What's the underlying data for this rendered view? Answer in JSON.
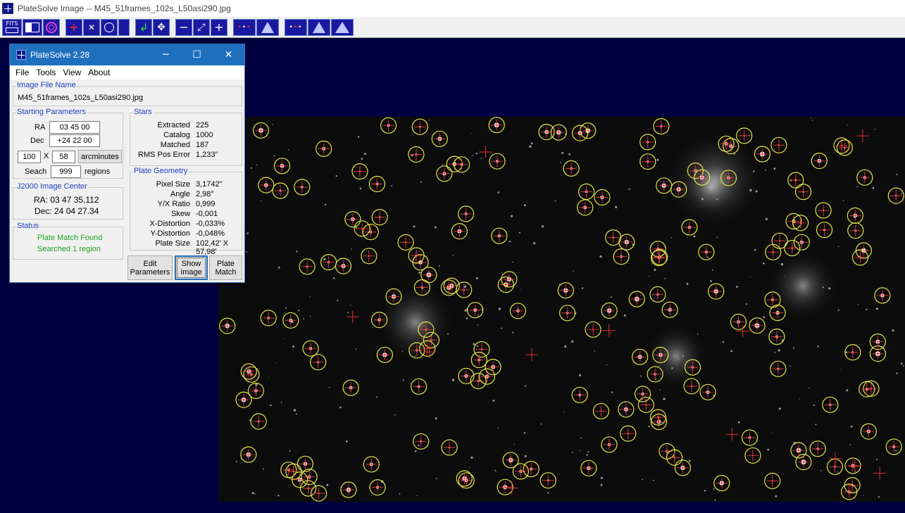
{
  "main_window": {
    "title": "PlateSolve Image -- M45_51frames_102s_L50asi290.jpg"
  },
  "toolbar": {
    "buttons": [
      {
        "name": "fits-button",
        "label": "FITS"
      },
      {
        "name": "image-layout-button",
        "icon": "panel-icon"
      },
      {
        "name": "target-circle-button",
        "icon": "target-icon"
      },
      {
        "name": "crosshair-button",
        "icon": "plus-icon"
      },
      {
        "name": "x-mark-button",
        "icon": "x-icon"
      },
      {
        "name": "circle-button",
        "icon": "circle-icon"
      },
      {
        "name": "blank-button",
        "icon": "blank-icon"
      },
      {
        "name": "rotate-button",
        "icon": "rotate-arrow-icon"
      },
      {
        "name": "move-button",
        "icon": "move-arrows-icon"
      },
      {
        "name": "zoom-out-button",
        "label": "−"
      },
      {
        "name": "fit-window-button",
        "icon": "expand-icon"
      },
      {
        "name": "zoom-in-button",
        "label": "+"
      },
      {
        "name": "stars-left-button",
        "icon": "dots-icon"
      },
      {
        "name": "histogram-button",
        "icon": "histogram-icon"
      },
      {
        "name": "stars-right-button",
        "icon": "dots-icon"
      },
      {
        "name": "histogram-red-button",
        "icon": "histogram-icon"
      },
      {
        "name": "histogram-wide-button",
        "icon": "histogram-icon"
      }
    ]
  },
  "dialog": {
    "title": "PlateSolve 2.28",
    "menu": [
      "File",
      "Tools",
      "View",
      "About"
    ],
    "image_file": {
      "legend": "Image File Name",
      "value": "M45_51frames_102s_L50asi290.jpg"
    },
    "starting": {
      "legend": "Starting Parameters",
      "ra_label": "RA",
      "ra_value": "03 45 00",
      "dec_label": "Dec",
      "dec_value": "+24 22 00",
      "width": "100",
      "x_label": "X",
      "height": "58",
      "units_button": "arcminutes",
      "search_label": "Seach",
      "search_value": "999",
      "search_units": "regions"
    },
    "center": {
      "legend": "J2000 Image Center",
      "ra": "RA: 03 47 35.112",
      "dec": "Dec: 24 04 27.34"
    },
    "status": {
      "legend": "Status",
      "line1": "Plate Match Found",
      "line2": "Searched 1 region"
    },
    "stars": {
      "legend": "Stars",
      "rows": [
        {
          "label": "Extracted",
          "value": "225"
        },
        {
          "label": "Catalog",
          "value": "1000"
        },
        {
          "label": "Matched",
          "value": "187"
        },
        {
          "label": "RMS Pos Error",
          "value": "1,233''"
        }
      ]
    },
    "geometry": {
      "legend": "Plate Geometry",
      "rows": [
        {
          "label": "Pixel Size",
          "value": "3,1742''"
        },
        {
          "label": "Angle",
          "value": "2,98°"
        },
        {
          "label": "Y/X Ratio",
          "value": "0,999"
        },
        {
          "label": "Skew",
          "value": "-0,001"
        },
        {
          "label": "X-Distortion",
          "value": "-0,033%"
        },
        {
          "label": "Y-Distortion",
          "value": "-0,048%"
        },
        {
          "label": "Plate Size",
          "value": "102,42' X 57,98'"
        }
      ]
    },
    "buttons": {
      "edit": "Edit Parameters",
      "show": "Show Image",
      "match": "Plate Match"
    }
  },
  "colors": {
    "circle": "#e6e64a",
    "cross": "#e03030",
    "background": "#000033",
    "title_bar": "#1f6fbf"
  }
}
